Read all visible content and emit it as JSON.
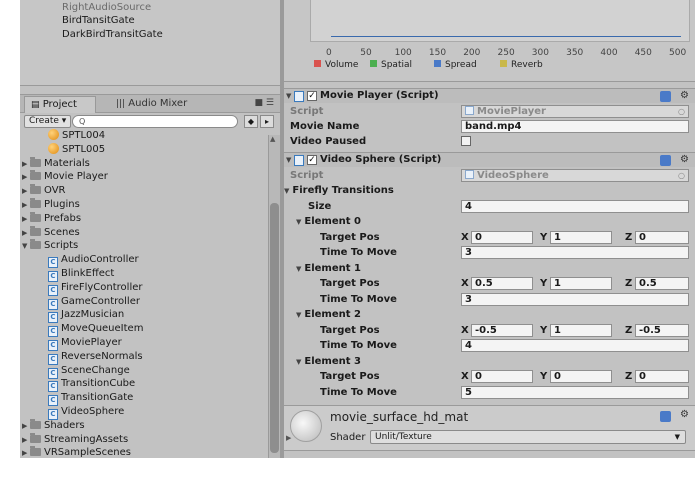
{
  "hierarchy": {
    "items": [
      "RightAudioSource",
      "BirdTansitGate",
      "DarkBirdTransitGate"
    ]
  },
  "project_panel": {
    "tab_project": "Project",
    "tab_audio_mixer": "Audio Mixer",
    "create_label": "Create ▾",
    "search_glyph": "Q",
    "tree": [
      {
        "label": "SPTL004",
        "kind": "material",
        "indent": 2
      },
      {
        "label": "SPTL005",
        "kind": "material",
        "indent": 2
      },
      {
        "label": "Materials",
        "kind": "folder",
        "indent": 0
      },
      {
        "label": "Movie Player",
        "kind": "folder",
        "indent": 0
      },
      {
        "label": "OVR",
        "kind": "folder",
        "indent": 0
      },
      {
        "label": "Plugins",
        "kind": "folder",
        "indent": 0
      },
      {
        "label": "Prefabs",
        "kind": "folder",
        "indent": 0
      },
      {
        "label": "Scenes",
        "kind": "folder",
        "indent": 0
      },
      {
        "label": "Scripts",
        "kind": "folder-open",
        "indent": 0
      },
      {
        "label": "AudioController",
        "kind": "script",
        "indent": 1
      },
      {
        "label": "BlinkEffect",
        "kind": "script",
        "indent": 1
      },
      {
        "label": "FireFlyController",
        "kind": "script",
        "indent": 1
      },
      {
        "label": "GameController",
        "kind": "script",
        "indent": 1
      },
      {
        "label": "JazzMusician",
        "kind": "script",
        "indent": 1
      },
      {
        "label": "MoveQueueItem",
        "kind": "script",
        "indent": 1
      },
      {
        "label": "MoviePlayer",
        "kind": "script",
        "indent": 1
      },
      {
        "label": "ReverseNormals",
        "kind": "script",
        "indent": 1
      },
      {
        "label": "SceneChange",
        "kind": "script",
        "indent": 1
      },
      {
        "label": "TransitionCube",
        "kind": "script",
        "indent": 1
      },
      {
        "label": "TransitionGate",
        "kind": "script",
        "indent": 1
      },
      {
        "label": "VideoSphere",
        "kind": "script",
        "indent": 1
      },
      {
        "label": "Shaders",
        "kind": "folder",
        "indent": 0
      },
      {
        "label": "StreamingAssets",
        "kind": "folder",
        "indent": 0
      },
      {
        "label": "VRSampleScenes",
        "kind": "folder",
        "indent": 0
      }
    ]
  },
  "audio_graph": {
    "ticks": [
      "0",
      "50",
      "100",
      "150",
      "200",
      "250",
      "300",
      "350",
      "400",
      "450",
      "500"
    ],
    "legend": [
      {
        "label": "Volume",
        "color": "#d9534f"
      },
      {
        "label": "Spatial",
        "color": "#4caf50"
      },
      {
        "label": "Spread",
        "color": "#4a7ac8"
      },
      {
        "label": "Reverb",
        "color": "#c9b84a"
      }
    ]
  },
  "movie_player": {
    "title": "Movie Player (Script)",
    "script_label": "Script",
    "script_value": "MoviePlayer",
    "movie_name_label": "Movie Name",
    "movie_name_value": "band.mp4",
    "video_paused_label": "Video Paused"
  },
  "video_sphere": {
    "title": "Video Sphere (Script)",
    "script_label": "Script",
    "script_value": "VideoSphere",
    "transitions_label": "Firefly Transitions",
    "size_label": "Size",
    "size_value": "4",
    "target_pos_label": "Target Pos",
    "time_to_move_label": "Time To Move",
    "elements": [
      {
        "label": "Element 0",
        "x": "0",
        "y": "1",
        "z": "0",
        "time": "3"
      },
      {
        "label": "Element 1",
        "x": "0.5",
        "y": "1",
        "z": "0.5",
        "time": "3"
      },
      {
        "label": "Element 2",
        "x": "-0.5",
        "y": "1",
        "z": "-0.5",
        "time": "4"
      },
      {
        "label": "Element 3",
        "x": "0",
        "y": "0",
        "z": "0",
        "time": "5"
      }
    ]
  },
  "material": {
    "name": "movie_surface_hd_mat",
    "shader_label": "Shader",
    "shader_value": "Unlit/Texture"
  },
  "axis_letters": {
    "x": "X",
    "y": "Y",
    "z": "Z"
  }
}
